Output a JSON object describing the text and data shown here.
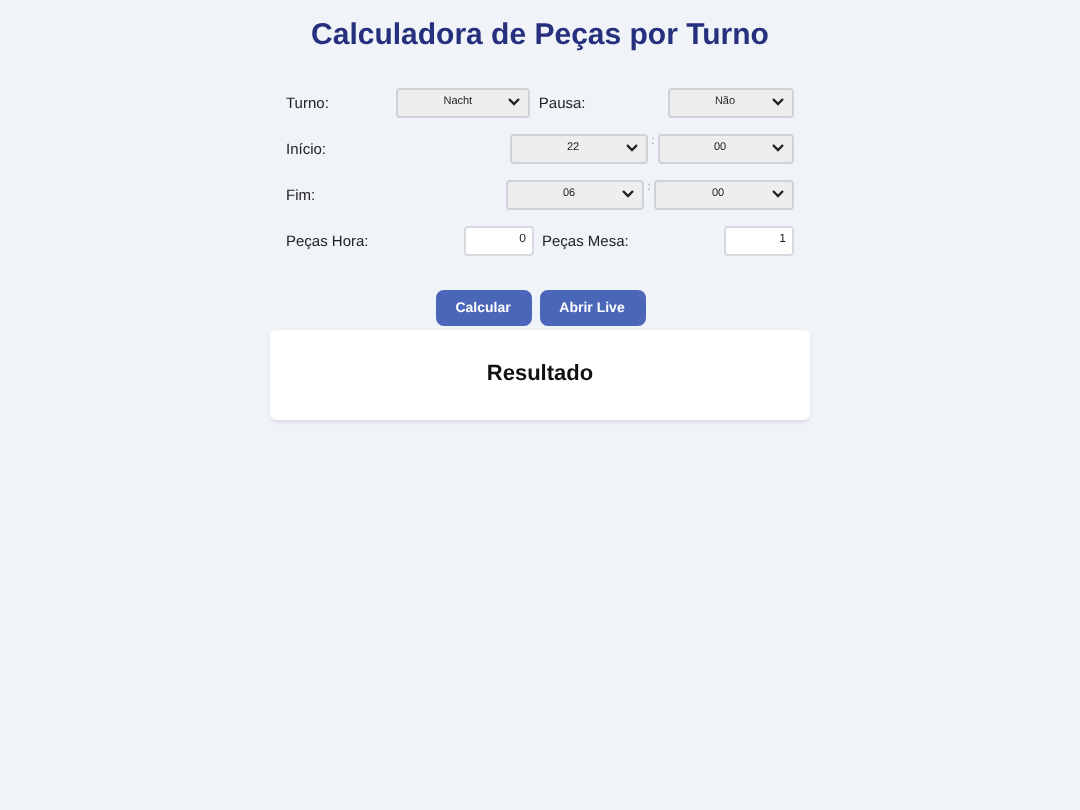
{
  "title": "Calculadora de Peças por Turno",
  "turno": {
    "label": "Turno:",
    "value": "Nacht"
  },
  "pausa": {
    "label": "Pausa:",
    "value": "Não"
  },
  "inicio": {
    "label": "Início:",
    "hour": "22",
    "separator": ":",
    "minute": "00"
  },
  "fim": {
    "label": "Fim:",
    "hour": "06",
    "separator": ":",
    "minute": "00"
  },
  "pecas_hora": {
    "label": "Peças Hora:",
    "value": "0"
  },
  "pecas_mesa": {
    "label": "Peças Mesa:",
    "value": "1"
  },
  "buttons": [
    "Calcular",
    "Abrir Live"
  ],
  "result": {
    "title": "Resultado"
  }
}
